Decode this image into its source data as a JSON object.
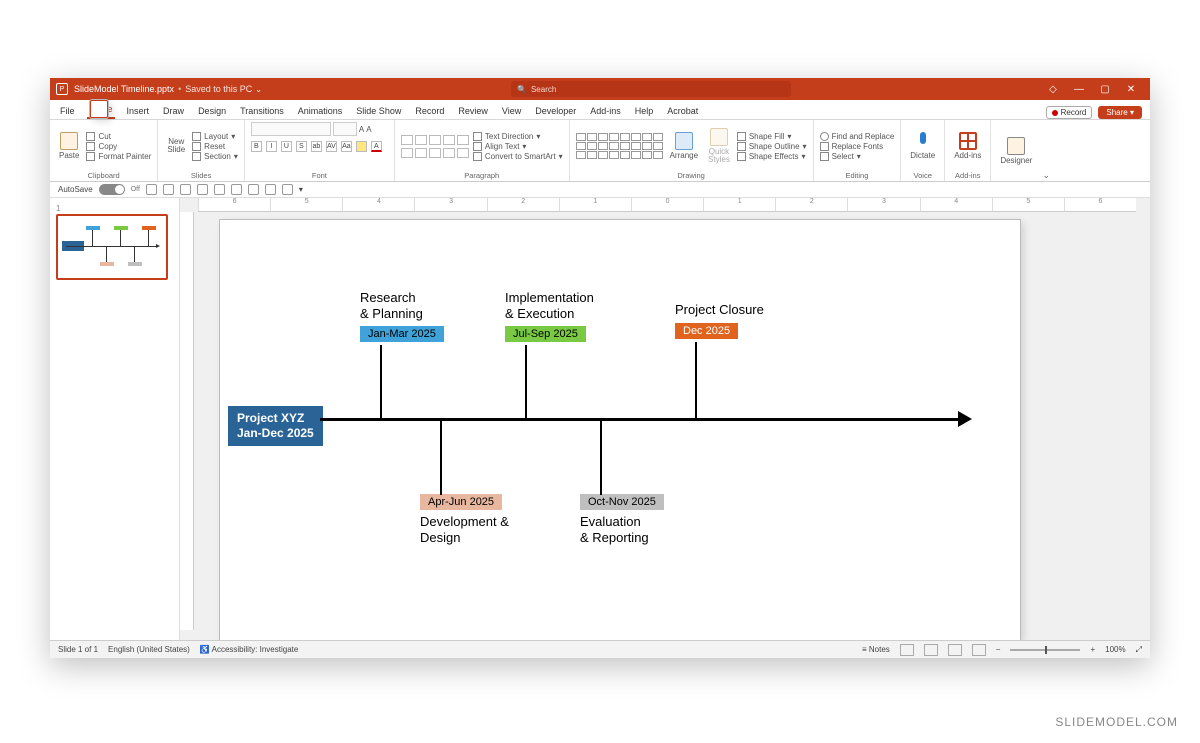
{
  "titlebar": {
    "filename": "SlideModel Timeline.pptx",
    "save_state": "Saved to this PC",
    "search_placeholder": "Search"
  },
  "tabs": [
    "File",
    "Home",
    "Insert",
    "Draw",
    "Design",
    "Transitions",
    "Animations",
    "Slide Show",
    "Record",
    "Review",
    "View",
    "Developer",
    "Add-ins",
    "Help",
    "Acrobat"
  ],
  "active_tab": "Home",
  "record_label": "Record",
  "share_label": "Share",
  "ribbon": {
    "clipboard": {
      "label": "Clipboard",
      "paste": "Paste",
      "cut": "Cut",
      "copy": "Copy",
      "format_painter": "Format Painter"
    },
    "slides": {
      "label": "Slides",
      "new_slide": "New\nSlide",
      "layout": "Layout",
      "reset": "Reset",
      "section": "Section"
    },
    "font": {
      "label": "Font"
    },
    "paragraph": {
      "label": "Paragraph",
      "text_direction": "Text Direction",
      "align_text": "Align Text",
      "smartart": "Convert to SmartArt"
    },
    "drawing": {
      "label": "Drawing",
      "arrange": "Arrange",
      "quick_styles": "Quick\nStyles",
      "shape_fill": "Shape Fill",
      "shape_outline": "Shape Outline",
      "shape_effects": "Shape Effects"
    },
    "editing": {
      "label": "Editing",
      "find": "Find and Replace",
      "replace": "Replace Fonts",
      "select": "Select"
    },
    "voice": {
      "label": "Voice",
      "dictate": "Dictate"
    },
    "addins": {
      "label": "Add-ins",
      "btn": "Add-ins"
    },
    "designer": {
      "label": "Designer",
      "btn": "Designer"
    }
  },
  "qat": {
    "autosave": "AutoSave",
    "autosave_state": "Off"
  },
  "statusbar": {
    "slide_pos": "Slide 1 of 1",
    "language": "English (United States)",
    "accessibility": "Accessibility: Investigate",
    "notes": "Notes",
    "zoom": "100%"
  },
  "chart_data": {
    "type": "timeline",
    "project": {
      "name": "Project XYZ",
      "range": "Jan-Dec 2025"
    },
    "milestones": [
      {
        "title": "Research\n& Planning",
        "date": "Jan-Mar 2025",
        "position": "above",
        "color": "#3fa2d9"
      },
      {
        "title": "Development &\nDesign",
        "date": "Apr-Jun 2025",
        "position": "below",
        "color": "#e7b79f"
      },
      {
        "title": "Implementation\n& Execution",
        "date": "Jul-Sep 2025",
        "position": "above",
        "color": "#7ac943"
      },
      {
        "title": "Evaluation\n& Reporting",
        "date": "Oct-Nov 2025",
        "position": "below",
        "color": "#bfbfbf"
      },
      {
        "title": "Project Closure",
        "date": "Dec 2025",
        "position": "above",
        "color": "#e0631e"
      }
    ]
  },
  "watermark": "SLIDEMODEL.COM"
}
